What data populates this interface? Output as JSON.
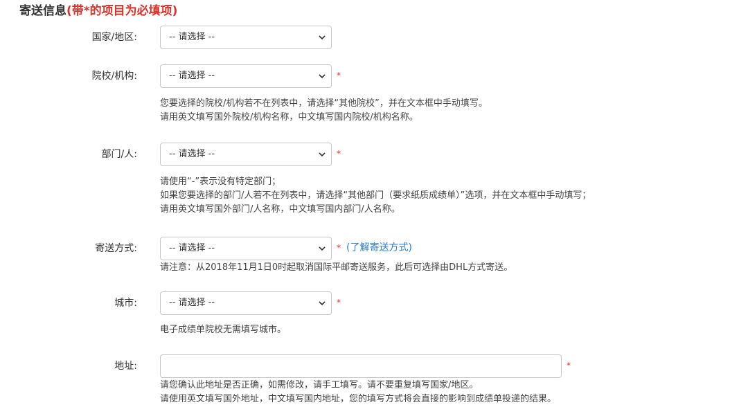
{
  "section": {
    "title": "寄送信息",
    "required_note": "(带*的项目为必填项)"
  },
  "fields": {
    "country": {
      "label": "国家/地区:",
      "value": "-- 请选择 --"
    },
    "school": {
      "label": "院校/机构:",
      "value": "-- 请选择 --",
      "required_mark": "*",
      "help": [
        "您要选择的院校/机构若不在列表中，请选择“其他院校”，并在文本框中手动填写。",
        "请用英文填写国外院校/机构名称，中文填写国内院校/机构名称。"
      ]
    },
    "department": {
      "label": "部门/人:",
      "value": "-- 请选择 --",
      "required_mark": "*",
      "help": [
        "请使用“-”表示没有特定部门；",
        "如果您要选择的部门/人若不在列表中，请选择“其他部门（要求纸质成绩单）”选项，并在文本框中手动填写；",
        "请用英文填写国外部门/人名称，中文填写国内部门/人名称。"
      ]
    },
    "shipping": {
      "label": "寄送方式:",
      "value": "-- 请选择 --",
      "required_mark": "*",
      "link": "(了解寄送方式)",
      "help": [
        "请注意：从2018年11月1日0时起取消国际平邮寄送服务，此后可选择由DHL方式寄送。"
      ]
    },
    "city": {
      "label": "城市:",
      "value": "-- 请选择 --",
      "required_mark": "*",
      "help": [
        "电子成绩单院校无需填写城市。"
      ]
    },
    "address": {
      "label": "地址:",
      "value": "",
      "placeholder": "",
      "required_mark": "*",
      "help": [
        "请您确认此地址是否正确，如需修改，请手工填写。请不要重复填写国家/地区。",
        "请使用英文填写国外地址，中文填写国内地址，您的填写方式将会直接的影响到成绩单投递的结果。"
      ]
    }
  },
  "icons": {
    "select_arrow": "chevron-down-icon"
  },
  "colors": {
    "required": "#d9322a",
    "link": "#2a7fd4",
    "border": "#c8c8c8"
  }
}
